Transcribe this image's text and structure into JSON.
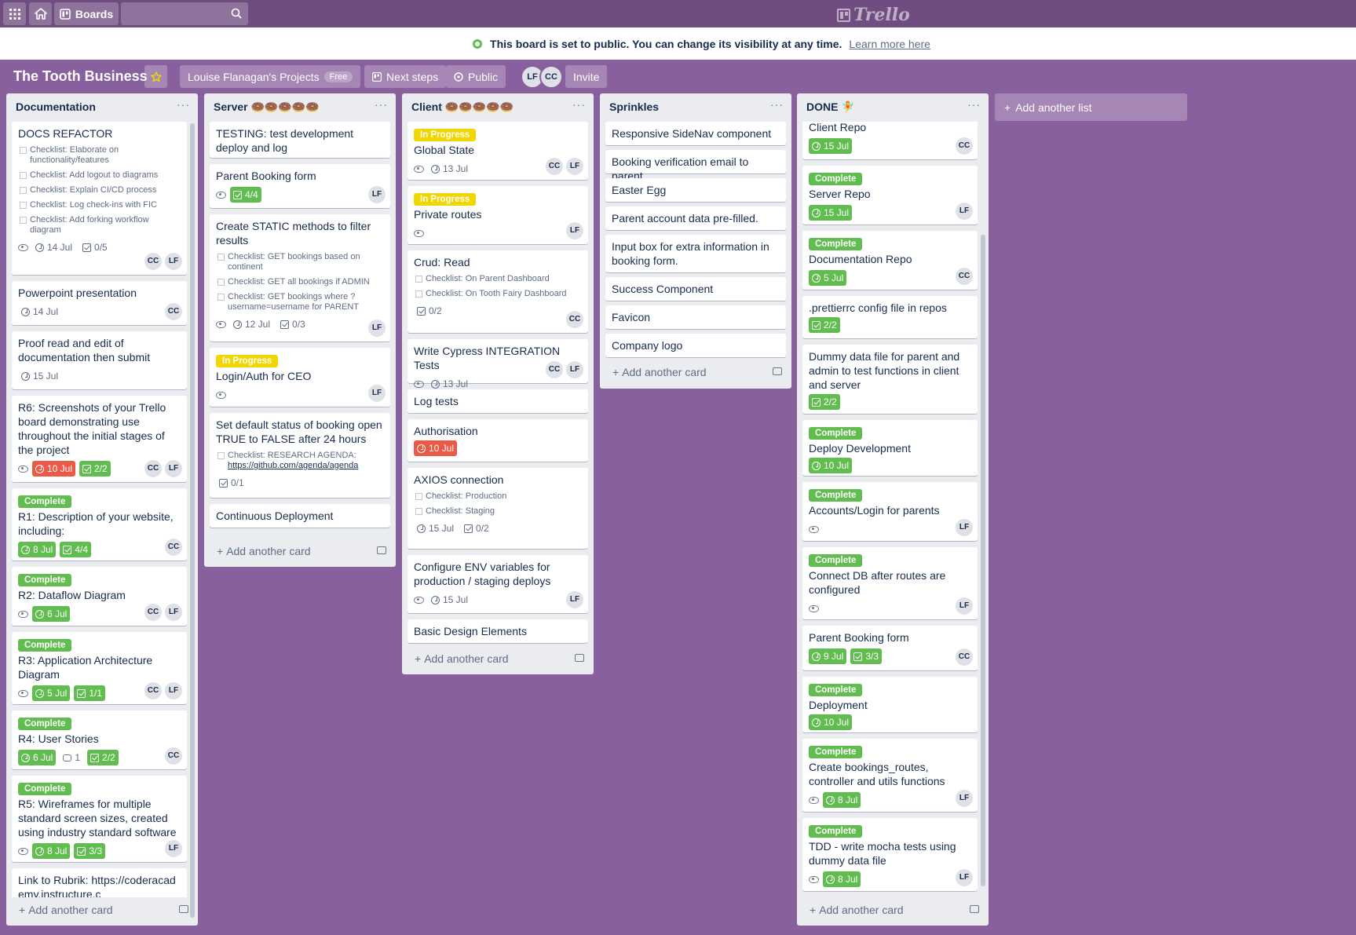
{
  "topbar": {
    "boards_label": "Boards",
    "logo_text": "Trello"
  },
  "notice": {
    "text": "This board is set to public. You can change its visibility at any time.",
    "link": "Learn more here"
  },
  "board": {
    "title": "The Tooth Business",
    "team": "Louise Flanagan's Projects",
    "team_badge": "Free",
    "next_steps": "Next steps",
    "visibility": "Public",
    "members": [
      "LF",
      "CC"
    ],
    "invite": "Invite"
  },
  "add_card_label": "Add another card",
  "add_list_label": "Add another list",
  "lists": [
    {
      "title": "Documentation"
    },
    {
      "title": "Server 🍩🍩🍩🍩🍩"
    },
    {
      "title": "Client 🍩🍩🍩🍩🍩"
    },
    {
      "title": "Sprinkles"
    },
    {
      "title": "DONE 🧚"
    }
  ],
  "cards": {
    "doc": [
      {
        "title": "DOCS REFACTOR",
        "checklist": [
          "Checklist: Elaborate on functionality/features",
          "Checklist: Add logout to diagrams",
          "Checklist: Explain CI/CD process",
          "Checklist: Log check-ins with FIC",
          "Checklist: Add forking workflow diagram"
        ],
        "date": "14 Jul",
        "check": "0/5",
        "members": [
          "CC",
          "LF"
        ]
      },
      {
        "title": "Powerpoint presentation",
        "date": "14 Jul",
        "members": [
          "CC"
        ]
      },
      {
        "title": "Proof read and edit of documentation then submit",
        "date": "15 Jul"
      },
      {
        "title": "R6: Screenshots of your Trello board demonstrating use throughout the initial stages of the project",
        "date": "10 Jul",
        "check": "2/2",
        "members": [
          "CC",
          "LF"
        ]
      },
      {
        "label": "Complete",
        "title": "R1: Description of your website, including:",
        "date": "8 Jul",
        "check": "4/4",
        "members": [
          "CC"
        ]
      },
      {
        "label": "Complete",
        "title": "R2: Dataflow Diagram",
        "date": "6 Jul",
        "members": [
          "CC",
          "LF"
        ]
      },
      {
        "label": "Complete",
        "title": "R3: Application Architecture Diagram",
        "date": "5 Jul",
        "check": "1/1",
        "members": [
          "CC",
          "LF"
        ]
      },
      {
        "label": "Complete",
        "title": "R4: User Stories",
        "date": "6 Jul",
        "comments": "1",
        "check": "2/2",
        "members": [
          "CC"
        ]
      },
      {
        "label": "Complete",
        "title": "R5: Wireframes for multiple standard screen sizes, created using industry standard software",
        "date": "8 Jul",
        "check": "3/3",
        "members": [
          "LF"
        ]
      },
      {
        "title": "Link to Rubrik: https://coderacademy.instructure.c"
      }
    ],
    "server": [
      {
        "title": "TESTING: test development deploy and log"
      },
      {
        "title": "Parent Booking form",
        "check": "4/4",
        "members": [
          "LF"
        ]
      },
      {
        "title": "Create STATIC methods to filter results",
        "checklist": [
          "Checklist: GET bookings based on continent",
          "Checklist: GET all bookings if ADMIN",
          "Checklist: GET bookings where ? username=username for PARENT"
        ],
        "date": "12 Jul",
        "check": "0/3",
        "members": [
          "LF"
        ]
      },
      {
        "label": "In Progress",
        "title": "Login/Auth for CEO",
        "members": [
          "LF"
        ]
      },
      {
        "title": "Set default status of booking open TRUE to FALSE after 24 hours",
        "checklist_text": "Checklist: RESEARCH AGENDA:",
        "checklist_link": "https://github.com/agenda/agenda",
        "check": "0/1"
      },
      {
        "title": "Continuous Deployment"
      }
    ],
    "client": [
      {
        "label": "In Progress",
        "title": "Global State",
        "date": "13 Jul",
        "members": [
          "CC",
          "LF"
        ]
      },
      {
        "label": "In Progress",
        "title": "Private routes",
        "members": [
          "LF"
        ]
      },
      {
        "title": "Crud: Read",
        "checklist": [
          "Checklist: On Parent Dashboard",
          "Checklist: On Tooth Fairy Dashboard"
        ],
        "check": "0/2",
        "members": [
          "CC"
        ]
      },
      {
        "title": "Write Cypress INTEGRATION Tests",
        "date": "13 Jul",
        "members": [
          "CC",
          "LF"
        ]
      },
      {
        "title": "Log tests"
      },
      {
        "title": "Authorisation",
        "date": "10 Jul"
      },
      {
        "title": "AXIOS connection",
        "checklist": [
          "Checklist: Production",
          "Checklist: Staging"
        ],
        "date": "15 Jul",
        "check": "0/2"
      },
      {
        "title": "Configure ENV variables for production / staging deploys",
        "date": "15 Jul",
        "members": [
          "LF"
        ]
      },
      {
        "title": "Basic Design Elements"
      }
    ],
    "sprinkles": [
      {
        "title": "Responsive SideNav component"
      },
      {
        "title": "Booking verification email to parent"
      },
      {
        "title": "Easter Egg"
      },
      {
        "title": "Parent account data pre-filled."
      },
      {
        "title": "Input box for extra information in booking form."
      },
      {
        "title": "Success Component"
      },
      {
        "title": "Favicon"
      },
      {
        "title": "Company logo"
      }
    ],
    "done": [
      {
        "title": "Client Repo",
        "date": "15 Jul",
        "members": [
          "CC"
        ]
      },
      {
        "label": "Complete",
        "title": "Server Repo",
        "date": "15 Jul",
        "members": [
          "LF"
        ]
      },
      {
        "label": "Complete",
        "title": "Documentation Repo",
        "date": "5 Jul",
        "members": [
          "CC"
        ]
      },
      {
        "title": ".prettierrc config file in repos",
        "check": "2/2"
      },
      {
        "title": "Dummy data file for parent and admin to test functions in client and server",
        "check": "2/2"
      },
      {
        "label": "Complete",
        "title": "Deploy Development",
        "date": "10 Jul"
      },
      {
        "label": "Complete",
        "title": "Accounts/Login for parents",
        "members": [
          "LF"
        ]
      },
      {
        "label": "Complete",
        "title": "Connect DB after routes are configured",
        "members": [
          "LF"
        ]
      },
      {
        "title": "Parent Booking form",
        "date": "9 Jul",
        "check": "3/3",
        "members": [
          "CC"
        ]
      },
      {
        "label": "Complete",
        "title": "Deployment",
        "date": "10 Jul"
      },
      {
        "label": "Complete",
        "title": "Create bookings_routes, controller and utils functions",
        "date": "8 Jul",
        "members": [
          "LF"
        ]
      },
      {
        "label": "Complete",
        "title": "TDD - write mocha tests using dummy data file",
        "date": "8 Jul",
        "members": [
          "LF"
        ]
      }
    ]
  }
}
